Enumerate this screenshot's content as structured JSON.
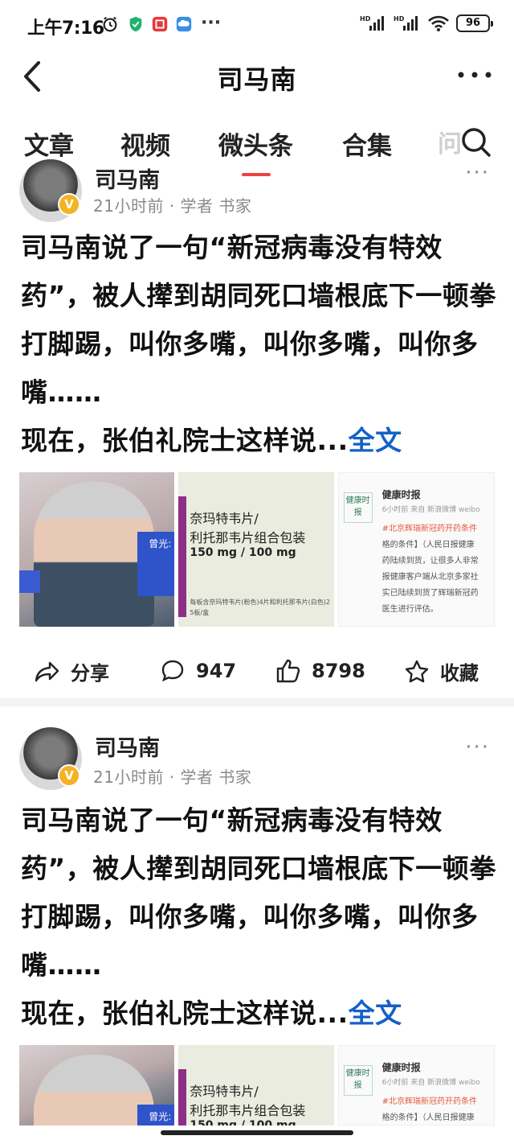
{
  "status_bar": {
    "time": "上午7:16",
    "battery": "96",
    "icons": [
      "alarm-icon",
      "shield-app-icon",
      "app-notification-icon",
      "cloud-app-icon",
      "more-notifications-icon",
      "hd-signal-icon",
      "hd-signal-icon",
      "wifi-icon",
      "battery-icon"
    ],
    "more_dots": "···"
  },
  "header": {
    "title": "司马南",
    "back_icon": "back-arrow-icon",
    "more_icon": "more-horizontal-icon"
  },
  "tabs": {
    "items": [
      {
        "label": "文章",
        "active": false
      },
      {
        "label": "视频",
        "active": false
      },
      {
        "label": "微头条",
        "active": true
      },
      {
        "label": "合集",
        "active": false
      }
    ],
    "overflow_label": "问",
    "search_icon": "search-icon"
  },
  "posts": [
    {
      "author": "司马南",
      "meta": "21小时前 · 学者 书家",
      "more": "···",
      "text": "司马南说了一句“新冠病毒没有特效药”，被人撵到胡同死口墙根底下一顿拳打脚踢，叫你多嘴，叫你多嘴，叫你多嘴……",
      "text_line2": "现在，张伯礼院士这样说...",
      "full_link": "全文",
      "images": {
        "img1_label": "曾光:",
        "img2_line1": "奈玛特韦片/",
        "img2_line2": "利托那韦片组合包装",
        "img2_line3": "150 mg / 100 mg",
        "img2_line4": "每板含奈玛特韦片(粉色)4片和利托那韦片(白色)2",
        "img2_line5": "5板/盒",
        "img3_logo": "健康时报",
        "img3_header": "健康时报",
        "img3_sub": "6小时前 来自 新浪微博 weibo",
        "img3_t1": "#北京辉瑞新冠药开药条件",
        "img3_t2": "格的条件】（人民日报健康",
        "img3_t3": "药陆续到货，让很多人非常",
        "img3_t4": "报健康客户端从北京多家社",
        "img3_t5": "实已陆续到货了辉瑞新冠药",
        "img3_t6": "医生进行评估。"
      },
      "actions": {
        "share_label": "分享",
        "comments": "947",
        "likes": "8798",
        "favorite_label": "收藏"
      }
    },
    {
      "author": "司马南",
      "meta": "21小时前 · 学者 书家",
      "more": "···",
      "text": "司马南说了一句“新冠病毒没有特效药”，被人撵到胡同死口墙根底下一顿拳打脚踢，叫你多嘴，叫你多嘴，叫你多嘴……",
      "text_line2": "现在，张伯礼院士这样说...",
      "full_link": "全文",
      "images": {
        "img1_label": "曾光:",
        "img2_line1": "奈玛特韦片/",
        "img2_line2": "利托那韦片组合包装",
        "img2_line3": "150 mg / 100 mg",
        "img3_logo": "健康时报",
        "img3_header": "健康时报",
        "img3_sub": "6小时前 来自 新浪微博 weibo",
        "img3_t1": "#北京辉瑞新冠药开药条件",
        "img3_t2": "格的条件】（人民日报健康"
      }
    }
  ]
}
